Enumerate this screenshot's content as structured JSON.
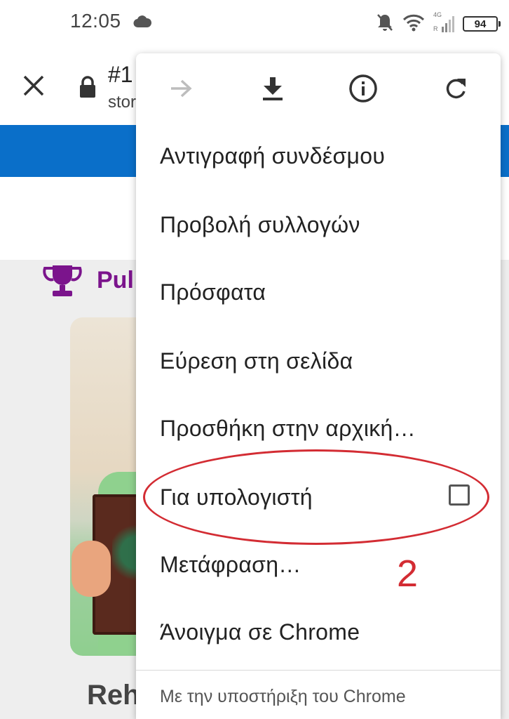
{
  "status_bar": {
    "time": "12:05",
    "network_label": "4G",
    "battery": "94"
  },
  "background_page": {
    "tab_title": "#1",
    "url_host": "stor",
    "section_text": "Pul",
    "name_text": "Reh",
    "accent_color": "#0a6fc9",
    "heading_color": "#7b148c"
  },
  "menu": {
    "icons": [
      "forward-arrow-icon",
      "download-icon",
      "info-icon",
      "refresh-icon"
    ],
    "items": [
      {
        "label": "Αντιγραφή συνδέσμου"
      },
      {
        "label": "Προβολή συλλογών"
      },
      {
        "label": "Πρόσφατα"
      },
      {
        "label": "Εύρεση στη σελίδα"
      },
      {
        "label": "Προσθήκη στην αρχική…"
      },
      {
        "label": "Για υπολογιστή",
        "checked": false
      },
      {
        "label": "Μετάφραση…"
      },
      {
        "label": "Άνοιγμα σε Chrome"
      }
    ],
    "footer": "Με την υποστήριξη του Chrome"
  },
  "annotation": {
    "number": "2",
    "color": "#d32c33"
  }
}
